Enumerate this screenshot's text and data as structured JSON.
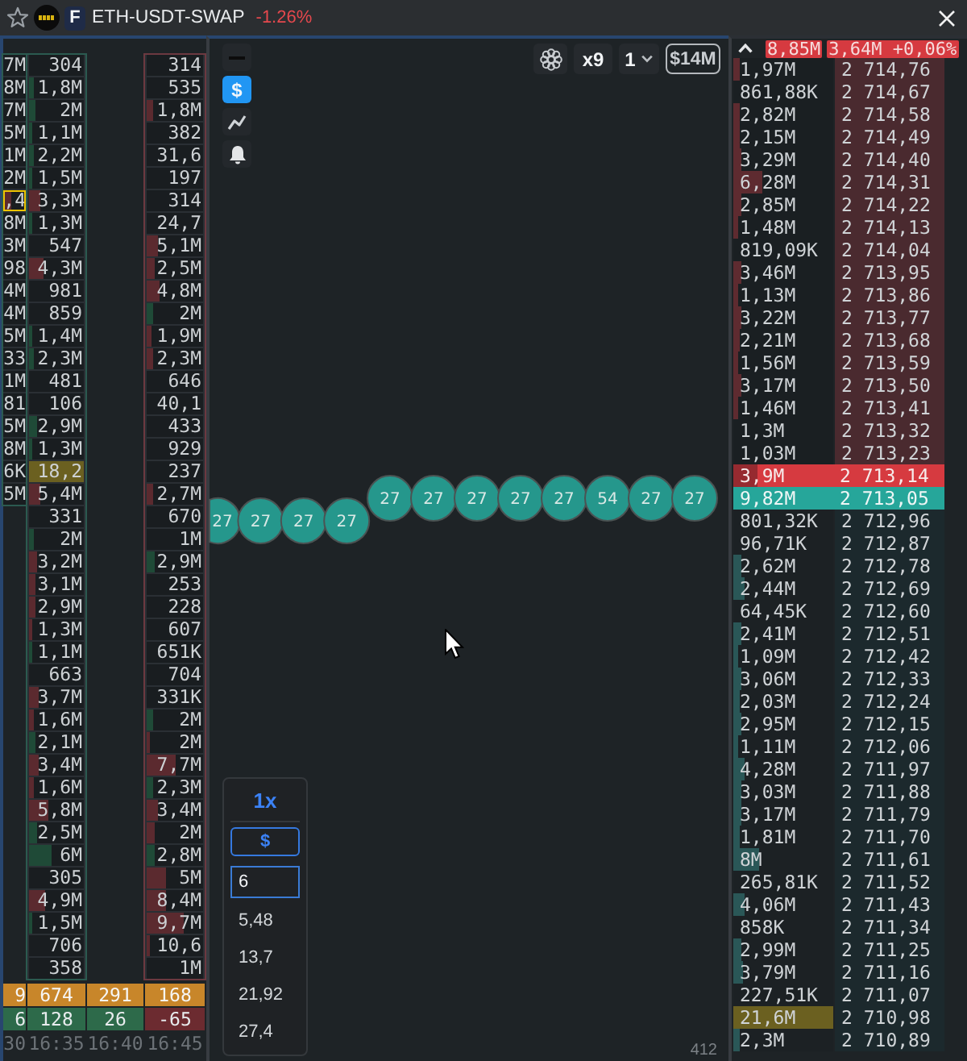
{
  "header": {
    "title": "ETH-USDT-SWAP",
    "market_badge": "F",
    "change": "-1.26%",
    "negative": true
  },
  "volume_columns": [
    {
      "cells": [
        {
          "value": "7M"
        },
        {
          "value": "8M"
        },
        {
          "value": "7M"
        },
        {
          "value": "5M"
        },
        {
          "value": "1M"
        },
        {
          "value": "2M"
        },
        {
          "value": ",4",
          "color": "#5b2a2f",
          "level": 0.33,
          "outlined": true
        },
        {
          "value": "8M"
        },
        {
          "value": "3M"
        },
        {
          "value": "98"
        },
        {
          "value": "4M"
        },
        {
          "value": "4M"
        },
        {
          "value": "5M"
        },
        {
          "value": "33"
        },
        {
          "value": "1M"
        },
        {
          "value": "81"
        },
        {
          "value": "5M"
        },
        {
          "value": "8M"
        },
        {
          "value": "6K"
        },
        {
          "value": "5M"
        }
      ],
      "total": "9",
      "delta": "6",
      "negative": false,
      "time": "30"
    },
    {
      "cells": [
        {
          "value": "304"
        },
        {
          "value": "1,8M",
          "color": "#1f4a37",
          "level": 0.09
        },
        {
          "value": "2M",
          "color": "#1f4a37",
          "level": 0.13
        },
        {
          "value": "1,1M",
          "color": "#1f4a37",
          "level": 0.05
        },
        {
          "value": "2,2M",
          "color": "#1f4a37",
          "level": 0.1
        },
        {
          "value": "1,5M",
          "color": "#1f4a37",
          "level": 0.05
        },
        {
          "value": "3,3M",
          "color": "#5b2a2f",
          "level": 0.2
        },
        {
          "value": "1,3M",
          "color": "#1f4a37",
          "level": 0.05
        },
        {
          "value": "547"
        },
        {
          "value": "4,3M",
          "color": "#5b2a2f",
          "level": 0.27
        },
        {
          "value": "981"
        },
        {
          "value": "859"
        },
        {
          "value": "1,4M",
          "color": "#1f4a37",
          "level": 0.05
        },
        {
          "value": "2,3M",
          "color": "#1f4a37",
          "level": 0.1
        },
        {
          "value": "481"
        },
        {
          "value": "106"
        },
        {
          "value": "2,9M",
          "color": "#1f4a37",
          "level": 0.15
        },
        {
          "value": "1,3M",
          "color": "#1f4a37",
          "level": 0.05
        },
        {
          "value": "18,2",
          "highlighted": true
        },
        {
          "value": "5,4M",
          "color": "#5b2a2f",
          "level": 0.2
        },
        {
          "value": "331"
        },
        {
          "value": "2M",
          "color": "#1f4a37",
          "level": 0.1
        },
        {
          "value": "3,2M",
          "color": "#5b2a2f",
          "level": 0.15
        },
        {
          "value": "3,1M",
          "color": "#5b2a2f",
          "level": 0.12
        },
        {
          "value": "2,9M",
          "color": "#5b2a2f",
          "level": 0.12
        },
        {
          "value": "1,3M",
          "color": "#5b2a2f",
          "level": 0.05
        },
        {
          "value": "1,1M",
          "color": "#1f4a37",
          "level": 0.05
        },
        {
          "value": "663"
        },
        {
          "value": "3,7M",
          "color": "#5b2a2f",
          "level": 0.18
        },
        {
          "value": "1,6M",
          "color": "#5b2a2f",
          "level": 0.1
        },
        {
          "value": "2,1M",
          "color": "#1f4a37",
          "level": 0.13
        },
        {
          "value": "3,4M",
          "color": "#5b2a2f",
          "level": 0.17
        },
        {
          "value": "1,6M",
          "color": "#5b2a2f",
          "level": 0.08
        },
        {
          "value": "5,8M",
          "color": "#5b2a2f",
          "level": 0.35
        },
        {
          "value": "2,5M",
          "color": "#1f4a37",
          "level": 0.15
        },
        {
          "value": "6M",
          "color": "#1f4a37",
          "level": 0.4
        },
        {
          "value": "305"
        },
        {
          "value": "4,9M",
          "color": "#5b2a2f",
          "level": 0.3
        },
        {
          "value": "1,5M",
          "color": "#1f4a37",
          "level": 0.05
        },
        {
          "value": "706"
        },
        {
          "value": "358"
        }
      ],
      "total": "674",
      "delta": "128",
      "negative": false,
      "time": "16:35"
    },
    {
      "total": "291",
      "delta": "26",
      "negative": false,
      "time": "16:40"
    },
    {
      "cells": [
        {
          "value": "314"
        },
        {
          "value": "535"
        },
        {
          "value": "1,8M",
          "color": "#5b2a2f",
          "level": 0.1
        },
        {
          "value": "382"
        },
        {
          "value": "31,6"
        },
        {
          "value": "197"
        },
        {
          "value": "314"
        },
        {
          "value": "24,7"
        },
        {
          "value": "5,1M",
          "color": "#5b2a2f",
          "level": 0.2
        },
        {
          "value": "2,5M",
          "color": "#5b2a2f",
          "level": 0.14
        },
        {
          "value": "4,8M",
          "color": "#5b2a2f",
          "level": 0.24
        },
        {
          "value": "2M",
          "color": "#1f4a37",
          "level": 0.1
        },
        {
          "value": "1,9M",
          "color": "#5b2a2f",
          "level": 0.08
        },
        {
          "value": "2,3M",
          "color": "#5b2a2f",
          "level": 0.1
        },
        {
          "value": "646"
        },
        {
          "value": "40,1"
        },
        {
          "value": "433"
        },
        {
          "value": "929"
        },
        {
          "value": "237"
        },
        {
          "value": "2,7M",
          "color": "#5b2a2f",
          "level": 0.12
        },
        {
          "value": "670"
        },
        {
          "value": "1M"
        },
        {
          "value": "2,9M",
          "color": "#1f4a37",
          "level": 0.15
        },
        {
          "value": "253"
        },
        {
          "value": "228"
        },
        {
          "value": "607"
        },
        {
          "value": "651K"
        },
        {
          "value": "704"
        },
        {
          "value": "331K"
        },
        {
          "value": "2M",
          "color": "#1f4a37",
          "level": 0.1
        },
        {
          "value": "2M",
          "color": "#5b2a2f",
          "level": 0.07
        },
        {
          "value": "7,7M",
          "color": "#5b2a2f",
          "level": 0.52
        },
        {
          "value": "2,3M",
          "color": "#1f4a37",
          "level": 0.1
        },
        {
          "value": "3,4M",
          "color": "#5b2a2f",
          "level": 0.2
        },
        {
          "value": "2M",
          "color": "#5b2a2f",
          "level": 0.14
        },
        {
          "value": "2,8M",
          "color": "#1f4a37",
          "level": 0.15
        },
        {
          "value": "5M",
          "color": "#5b2a2f",
          "level": 0.33
        },
        {
          "value": "8,4M",
          "color": "#5b2a2f",
          "level": 0.33
        },
        {
          "value": "9,7M",
          "color": "#5b2a2f",
          "level": 0.67
        },
        {
          "value": "10,6",
          "color": "#5b2a2f",
          "level": 0.05
        },
        {
          "value": "1M"
        }
      ],
      "total": "168",
      "delta": "-65",
      "negative": true,
      "time": "16:45"
    }
  ],
  "chart": {
    "tools": [
      {
        "kind": "line",
        "selected": false
      },
      {
        "kind": "label",
        "label": "$",
        "selected": true
      },
      {
        "kind": "chart",
        "selected": false
      },
      {
        "kind": "bell",
        "selected": false
      }
    ],
    "toolbar": [
      {
        "kind": "gear"
      },
      {
        "kind": "button",
        "label": "x9"
      },
      {
        "kind": "dropdown",
        "label": "1"
      },
      {
        "kind": "outlined",
        "label": "$14M"
      }
    ],
    "bubble_rows": [
      {
        "labels": [
          "27",
          "27",
          "27",
          "27"
        ]
      },
      {
        "labels": [
          "27",
          "27",
          "27",
          "27",
          "27",
          "54",
          "27",
          "27"
        ]
      }
    ],
    "size_panel": {
      "multiplier": "1x",
      "unit": "$",
      "input_value": "6",
      "presets": [
        "5,48",
        "13,7",
        "21,92",
        "27,4"
      ]
    },
    "corner_label": "412"
  },
  "order_book": {
    "header": {
      "volume": "8,85M",
      "summary": "3,64M +0,06%"
    },
    "asks": [
      {
        "volume": "1,97M",
        "price": "2 714,76",
        "level": 0.07
      },
      {
        "volume": "861,88K",
        "price": "2 714,67"
      },
      {
        "volume": "2,82M",
        "price": "2 714,58",
        "level": 0.07
      },
      {
        "volume": "2,15M",
        "price": "2 714,49",
        "level": 0.06
      },
      {
        "volume": "3,29M",
        "price": "2 714,40",
        "level": 0.08
      },
      {
        "volume": "6,28M",
        "price": "2 714,31",
        "level": 0.29
      },
      {
        "volume": "2,85M",
        "price": "2 714,22",
        "level": 0.08
      },
      {
        "volume": "1,48M",
        "price": "2 714,13",
        "level": 0.05
      },
      {
        "volume": "819,09K",
        "price": "2 714,04"
      },
      {
        "volume": "3,46M",
        "price": "2 713,95",
        "level": 0.08
      },
      {
        "volume": "1,13M",
        "price": "2 713,86",
        "level": 0.05
      },
      {
        "volume": "3,22M",
        "price": "2 713,77",
        "level": 0.08
      },
      {
        "volume": "2,21M",
        "price": "2 713,68",
        "level": 0.07
      },
      {
        "volume": "1,56M",
        "price": "2 713,59",
        "level": 0.05
      },
      {
        "volume": "3,17M",
        "price": "2 713,50",
        "level": 0.08
      },
      {
        "volume": "1,46M",
        "price": "2 713,41",
        "level": 0.05
      },
      {
        "volume": "1,3M",
        "price": "2 713,32"
      },
      {
        "volume": "1,03M",
        "price": "2 713,23"
      }
    ],
    "best_ask": {
      "volume": "3,9M",
      "price": "2 713,14",
      "level": 0.24
    },
    "best_bid": {
      "volume": "9,82M",
      "price": "2 713,05"
    },
    "bids": [
      {
        "volume": "801,32K",
        "price": "2 712,96"
      },
      {
        "volume": "96,71K",
        "price": "2 712,87"
      },
      {
        "volume": "2,62M",
        "price": "2 712,78",
        "level": 0.08
      },
      {
        "volume": "2,44M",
        "price": "2 712,69",
        "level": 0.11
      },
      {
        "volume": "64,45K",
        "price": "2 712,60"
      },
      {
        "volume": "2,41M",
        "price": "2 712,51",
        "level": 0.08
      },
      {
        "volume": "1,09M",
        "price": "2 712,42",
        "level": 0.05
      },
      {
        "volume": "3,06M",
        "price": "2 712,33",
        "level": 0.08
      },
      {
        "volume": "2,03M",
        "price": "2 712,24",
        "level": 0.06
      },
      {
        "volume": "2,95M",
        "price": "2 712,15",
        "level": 0.08
      },
      {
        "volume": "1,11M",
        "price": "2 712,06",
        "level": 0.05
      },
      {
        "volume": "4,28M",
        "price": "2 711,97",
        "level": 0.12
      },
      {
        "volume": "3,03M",
        "price": "2 711,88",
        "level": 0.08
      },
      {
        "volume": "3,17M",
        "price": "2 711,79",
        "level": 0.08
      },
      {
        "volume": "1,81M",
        "price": "2 711,70",
        "level": 0.06
      },
      {
        "volume": "8M",
        "price": "2 711,61",
        "level": 0.25
      },
      {
        "volume": "265,81K",
        "price": "2 711,52"
      },
      {
        "volume": "4,06M",
        "price": "2 711,43",
        "level": 0.11
      },
      {
        "volume": "858K",
        "price": "2 711,34"
      },
      {
        "volume": "2,99M",
        "price": "2 711,25",
        "level": 0.08
      },
      {
        "volume": "3,79M",
        "price": "2 711,16",
        "level": 0.1
      },
      {
        "volume": "227,51K",
        "price": "2 711,07"
      },
      {
        "volume": "21,6M",
        "price": "2 710,98",
        "highlighted": true
      },
      {
        "volume": "2,3M",
        "price": "2 710,89",
        "level": 0.06
      }
    ]
  }
}
